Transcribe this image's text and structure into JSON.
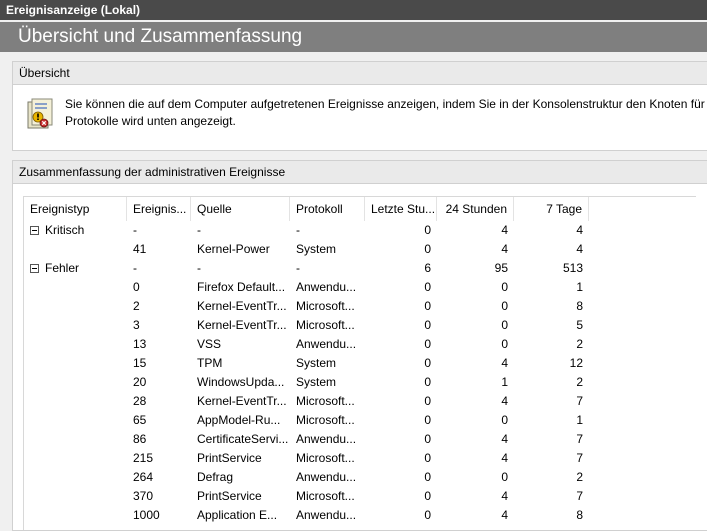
{
  "window": {
    "title": "Ereignisanzeige (Lokal)"
  },
  "banner": {
    "title": "Übersicht und Zusammenfassung"
  },
  "overview": {
    "header": "Übersicht",
    "icon": "event-log-icon",
    "line1": "Sie können die auf dem Computer aufgetretenen Ereignisse anzeigen, indem Sie in der Konsolenstruktur den Knoten für di",
    "line2": "Protokolle wird unten angezeigt."
  },
  "summary": {
    "header": "Zusammenfassung der administrativen Ereignisse",
    "columns": [
      "Ereignistyp",
      "Ereignis...",
      "Quelle",
      "Protokoll",
      "Letzte Stu...",
      "24 Stunden",
      "7 Tage"
    ],
    "rows": [
      {
        "type": "Kritisch",
        "expander": true,
        "id": "-",
        "source": "-",
        "log": "-",
        "hour": "0",
        "day": "4",
        "week": "4"
      },
      {
        "type": "",
        "expander": false,
        "id": "41",
        "source": "Kernel-Power",
        "log": "System",
        "hour": "0",
        "day": "4",
        "week": "4"
      },
      {
        "type": "Fehler",
        "expander": true,
        "id": "-",
        "source": "-",
        "log": "-",
        "hour": "6",
        "day": "95",
        "week": "513"
      },
      {
        "type": "",
        "expander": false,
        "id": "0",
        "source": "Firefox Default...",
        "log": "Anwendu...",
        "hour": "0",
        "day": "0",
        "week": "1"
      },
      {
        "type": "",
        "expander": false,
        "id": "2",
        "source": "Kernel-EventTr...",
        "log": "Microsoft...",
        "hour": "0",
        "day": "0",
        "week": "8"
      },
      {
        "type": "",
        "expander": false,
        "id": "3",
        "source": "Kernel-EventTr...",
        "log": "Microsoft...",
        "hour": "0",
        "day": "0",
        "week": "5"
      },
      {
        "type": "",
        "expander": false,
        "id": "13",
        "source": "VSS",
        "log": "Anwendu...",
        "hour": "0",
        "day": "0",
        "week": "2"
      },
      {
        "type": "",
        "expander": false,
        "id": "15",
        "source": "TPM",
        "log": "System",
        "hour": "0",
        "day": "4",
        "week": "12"
      },
      {
        "type": "",
        "expander": false,
        "id": "20",
        "source": "WindowsUpda...",
        "log": "System",
        "hour": "0",
        "day": "1",
        "week": "2"
      },
      {
        "type": "",
        "expander": false,
        "id": "28",
        "source": "Kernel-EventTr...",
        "log": "Microsoft...",
        "hour": "0",
        "day": "4",
        "week": "7"
      },
      {
        "type": "",
        "expander": false,
        "id": "65",
        "source": "AppModel-Ru...",
        "log": "Microsoft...",
        "hour": "0",
        "day": "0",
        "week": "1"
      },
      {
        "type": "",
        "expander": false,
        "id": "86",
        "source": "CertificateServi...",
        "log": "Anwendu...",
        "hour": "0",
        "day": "4",
        "week": "7"
      },
      {
        "type": "",
        "expander": false,
        "id": "215",
        "source": "PrintService",
        "log": "Microsoft...",
        "hour": "0",
        "day": "4",
        "week": "7"
      },
      {
        "type": "",
        "expander": false,
        "id": "264",
        "source": "Defrag",
        "log": "Anwendu...",
        "hour": "0",
        "day": "0",
        "week": "2"
      },
      {
        "type": "",
        "expander": false,
        "id": "370",
        "source": "PrintService",
        "log": "Microsoft...",
        "hour": "0",
        "day": "4",
        "week": "7"
      },
      {
        "type": "",
        "expander": false,
        "id": "1000",
        "source": "Application E...",
        "log": "Anwendu...",
        "hour": "0",
        "day": "4",
        "week": "8"
      }
    ]
  }
}
